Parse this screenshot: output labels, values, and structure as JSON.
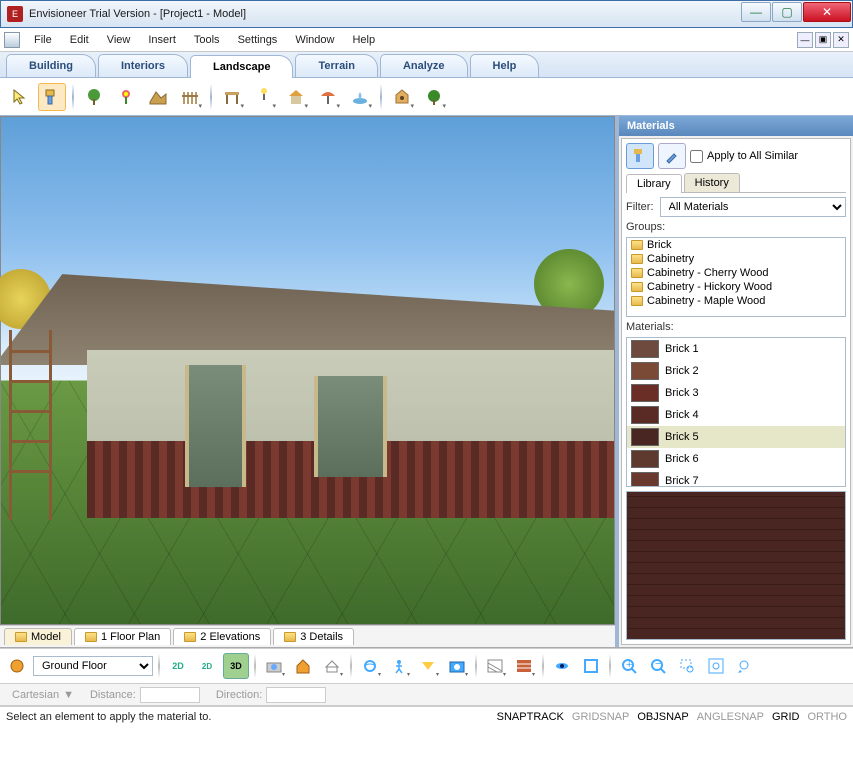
{
  "window": {
    "title": "Envisioneer Trial Version - [Project1 - Model]"
  },
  "menus": [
    "File",
    "Edit",
    "View",
    "Insert",
    "Tools",
    "Settings",
    "Window",
    "Help"
  ],
  "tabs": [
    "Building",
    "Interiors",
    "Landscape",
    "Terrain",
    "Analyze",
    "Help"
  ],
  "active_tab": 2,
  "toolbar_icons": [
    {
      "name": "pointer",
      "dd": false
    },
    {
      "name": "paintbrush",
      "dd": false,
      "selected": true
    },
    {
      "name": "plant-tree",
      "dd": false
    },
    {
      "name": "plant-flower",
      "dd": false
    },
    {
      "name": "terrain-slope",
      "dd": false
    },
    {
      "name": "fence",
      "dd": true
    },
    {
      "name": "pergola",
      "dd": true
    },
    {
      "name": "light",
      "dd": true
    },
    {
      "name": "gazebo",
      "dd": true
    },
    {
      "name": "umbrella",
      "dd": true
    },
    {
      "name": "fountain",
      "dd": true
    },
    {
      "name": "birdhouse",
      "dd": true
    },
    {
      "name": "shrub",
      "dd": true
    }
  ],
  "materials_panel": {
    "title": "Materials",
    "apply_all_label": "Apply to All Similar",
    "tabs": [
      "Library",
      "History"
    ],
    "active_tab": 0,
    "filter_label": "Filter:",
    "filter_value": "All Materials",
    "groups_label": "Groups:",
    "groups": [
      "Brick",
      "Cabinetry",
      "Cabinetry - Cherry Wood",
      "Cabinetry - Hickory Wood",
      "Cabinetry - Maple Wood"
    ],
    "materials_label": "Materials:",
    "materials": [
      {
        "name": "Brick 1",
        "c": "#6e4a3e"
      },
      {
        "name": "Brick 2",
        "c": "#7a4a36"
      },
      {
        "name": "Brick 3",
        "c": "#6a2e26"
      },
      {
        "name": "Brick 4",
        "c": "#5a2a24"
      },
      {
        "name": "Brick 5",
        "c": "#4a2622"
      },
      {
        "name": "Brick 6",
        "c": "#5e3a2e"
      },
      {
        "name": "Brick 7",
        "c": "#6a3a30"
      }
    ],
    "selected_material": 4
  },
  "view_tabs": [
    "Model",
    "1 Floor Plan",
    "2 Elevations",
    "3 Details"
  ],
  "active_view_tab": 0,
  "location_label": "Ground Floor",
  "coord": {
    "system": "Cartesian",
    "dist_label": "Distance:",
    "dir_label": "Direction:"
  },
  "status_text": "Select an element to apply the material to.",
  "snaps": [
    {
      "t": "SNAPTRACK",
      "on": true
    },
    {
      "t": "GRIDSNAP",
      "on": false
    },
    {
      "t": "OBJSNAP",
      "on": true
    },
    {
      "t": "ANGLESNAP",
      "on": false
    },
    {
      "t": "GRID",
      "on": true
    },
    {
      "t": "ORTHO",
      "on": false
    }
  ]
}
